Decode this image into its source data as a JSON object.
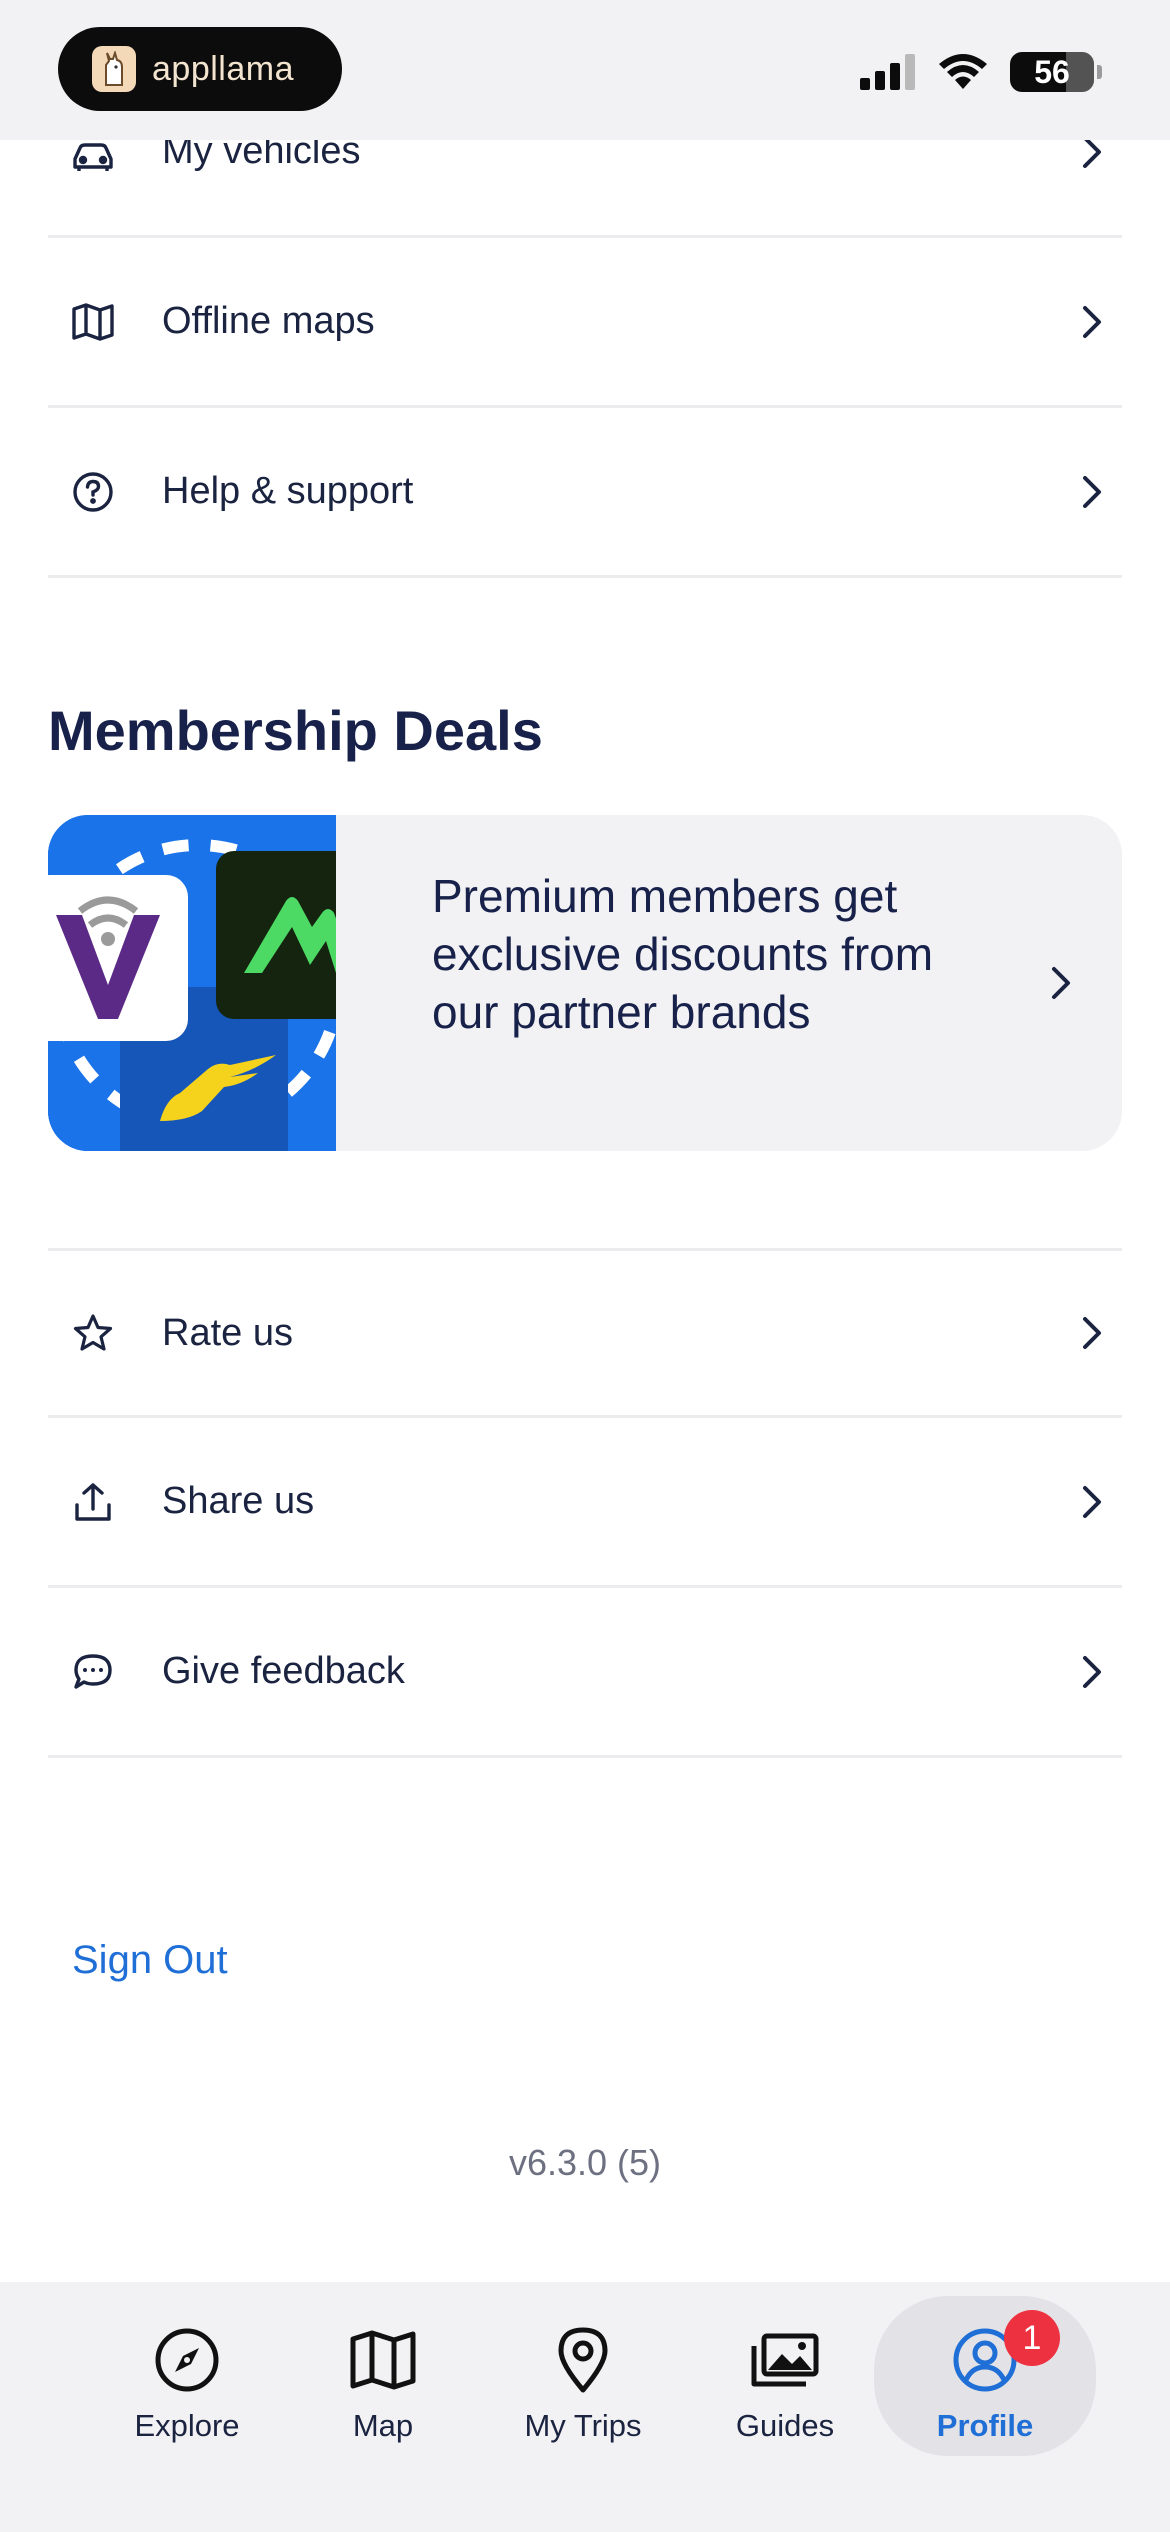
{
  "status_bar": {
    "app_name": "appllama",
    "battery": "56"
  },
  "menu_top": [
    {
      "label": "My vehicles",
      "icon": "car-icon"
    },
    {
      "label": "Offline maps",
      "icon": "map-icon"
    },
    {
      "label": "Help & support",
      "icon": "help-circle-icon"
    }
  ],
  "membership": {
    "title": "Membership Deals",
    "deal_text": "Premium members get exclusive discounts from our partner brands",
    "partner_icons": [
      "v-logo-icon",
      "mountain-logo-icon",
      "winged-foot-logo-icon"
    ],
    "colors": {
      "art_bg": "#1a73e8",
      "mountain_bg": "#14240f",
      "mountain_fg": "#4cd964",
      "v_purple": "#5b2a86"
    }
  },
  "menu_bottom": [
    {
      "label": "Rate us",
      "icon": "star-icon"
    },
    {
      "label": "Share us",
      "icon": "share-icon"
    },
    {
      "label": "Give feedback",
      "icon": "chat-bubble-icon"
    }
  ],
  "sign_out": "Sign Out",
  "version": "v6.3.0 (5)",
  "tabs": [
    {
      "label": "Explore",
      "icon": "compass-icon"
    },
    {
      "label": "Map",
      "icon": "map-icon"
    },
    {
      "label": "My Trips",
      "icon": "location-pin-icon"
    },
    {
      "label": "Guides",
      "icon": "image-gallery-icon"
    },
    {
      "label": "Profile",
      "icon": "user-circle-icon",
      "active": true,
      "badge": "1"
    }
  ],
  "colors": {
    "accent": "#1f6fd6",
    "text": "#1a2340",
    "badge": "#ee3140"
  }
}
